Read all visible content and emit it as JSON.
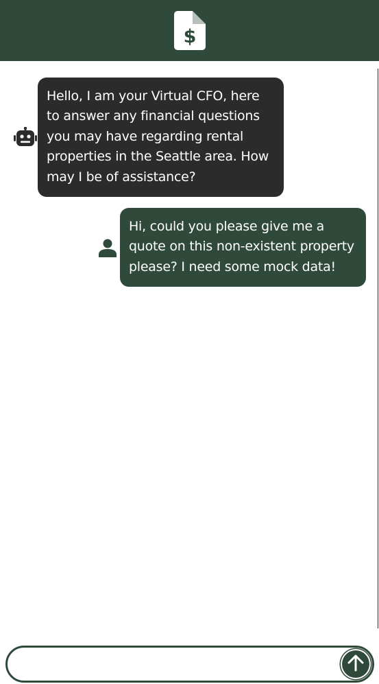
{
  "header": {
    "logo_icon": "invoice-dollar-icon",
    "brand_color": "#2f4a3b"
  },
  "messages": [
    {
      "sender": "bot",
      "avatar_icon": "robot-icon",
      "text": "Hello, I am your Virtual CFO, here to answer any financial questions you may have regarding rental properties in the Seattle area. How may I be of assistance?"
    },
    {
      "sender": "user",
      "avatar_icon": "user-icon",
      "text": "Hi, could you please give me a quote on this non-existent property please? I need some mock data!"
    }
  ],
  "composer": {
    "value": "",
    "placeholder": "",
    "send_icon": "arrow-up-icon"
  },
  "colors": {
    "bot_bubble": "#2b2b2b",
    "user_bubble": "#2f4a3b",
    "text_on_bubble": "#ffffff"
  }
}
